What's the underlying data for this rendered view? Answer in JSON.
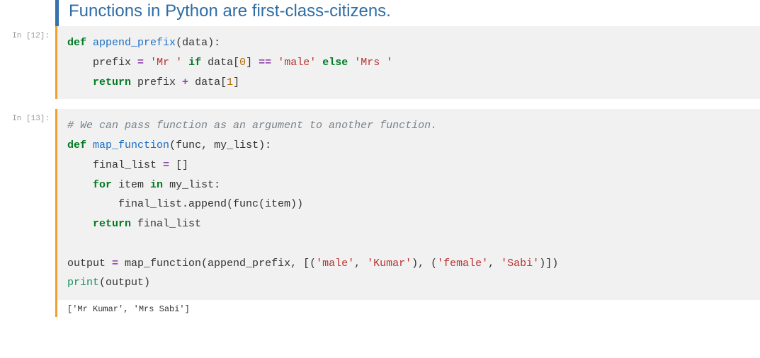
{
  "heading": "Functions in Python are first-class-citizens.",
  "cells": [
    {
      "prompt": "In [12]:",
      "tokens": [
        {
          "c": "kw",
          "t": "def"
        },
        {
          "t": " "
        },
        {
          "c": "fn",
          "t": "append_prefix"
        },
        {
          "t": "(data):"
        },
        {
          "t": "\n"
        },
        {
          "t": "    prefix "
        },
        {
          "c": "op",
          "t": "="
        },
        {
          "t": " "
        },
        {
          "c": "str",
          "t": "'Mr '"
        },
        {
          "t": " "
        },
        {
          "c": "kw",
          "t": "if"
        },
        {
          "t": " data["
        },
        {
          "c": "num",
          "t": "0"
        },
        {
          "t": "] "
        },
        {
          "c": "op",
          "t": "=="
        },
        {
          "t": " "
        },
        {
          "c": "str",
          "t": "'male'"
        },
        {
          "t": " "
        },
        {
          "c": "kw",
          "t": "else"
        },
        {
          "t": " "
        },
        {
          "c": "str",
          "t": "'Mrs '"
        },
        {
          "t": "\n"
        },
        {
          "t": "    "
        },
        {
          "c": "kw",
          "t": "return"
        },
        {
          "t": " prefix "
        },
        {
          "c": "op",
          "t": "+"
        },
        {
          "t": " data["
        },
        {
          "c": "num",
          "t": "1"
        },
        {
          "t": "]"
        }
      ]
    },
    {
      "prompt": "In [13]:",
      "tokens": [
        {
          "c": "cmt",
          "t": "# We can pass function as an argument to another function."
        },
        {
          "t": "\n"
        },
        {
          "c": "kw",
          "t": "def"
        },
        {
          "t": " "
        },
        {
          "c": "fn",
          "t": "map_function"
        },
        {
          "t": "(func, my_list):"
        },
        {
          "t": "\n"
        },
        {
          "t": "    final_list "
        },
        {
          "c": "op",
          "t": "="
        },
        {
          "t": " []"
        },
        {
          "t": "\n"
        },
        {
          "t": "    "
        },
        {
          "c": "kw",
          "t": "for"
        },
        {
          "t": " item "
        },
        {
          "c": "kw",
          "t": "in"
        },
        {
          "t": " my_list:"
        },
        {
          "t": "\n"
        },
        {
          "t": "        final_list.append(func(item))"
        },
        {
          "t": "\n"
        },
        {
          "t": "    "
        },
        {
          "c": "kw",
          "t": "return"
        },
        {
          "t": " final_list"
        },
        {
          "t": "\n"
        },
        {
          "t": "\n"
        },
        {
          "t": "output "
        },
        {
          "c": "op",
          "t": "="
        },
        {
          "t": " map_function(append_prefix, [("
        },
        {
          "c": "str",
          "t": "'male'"
        },
        {
          "t": ", "
        },
        {
          "c": "str",
          "t": "'Kumar'"
        },
        {
          "t": "), ("
        },
        {
          "c": "str",
          "t": "'female'"
        },
        {
          "t": ", "
        },
        {
          "c": "str",
          "t": "'Sabi'"
        },
        {
          "t": ")])"
        },
        {
          "t": "\n"
        },
        {
          "c": "builtin",
          "t": "print"
        },
        {
          "t": "(output)"
        }
      ],
      "output": "['Mr Kumar', 'Mrs Sabi']"
    }
  ]
}
